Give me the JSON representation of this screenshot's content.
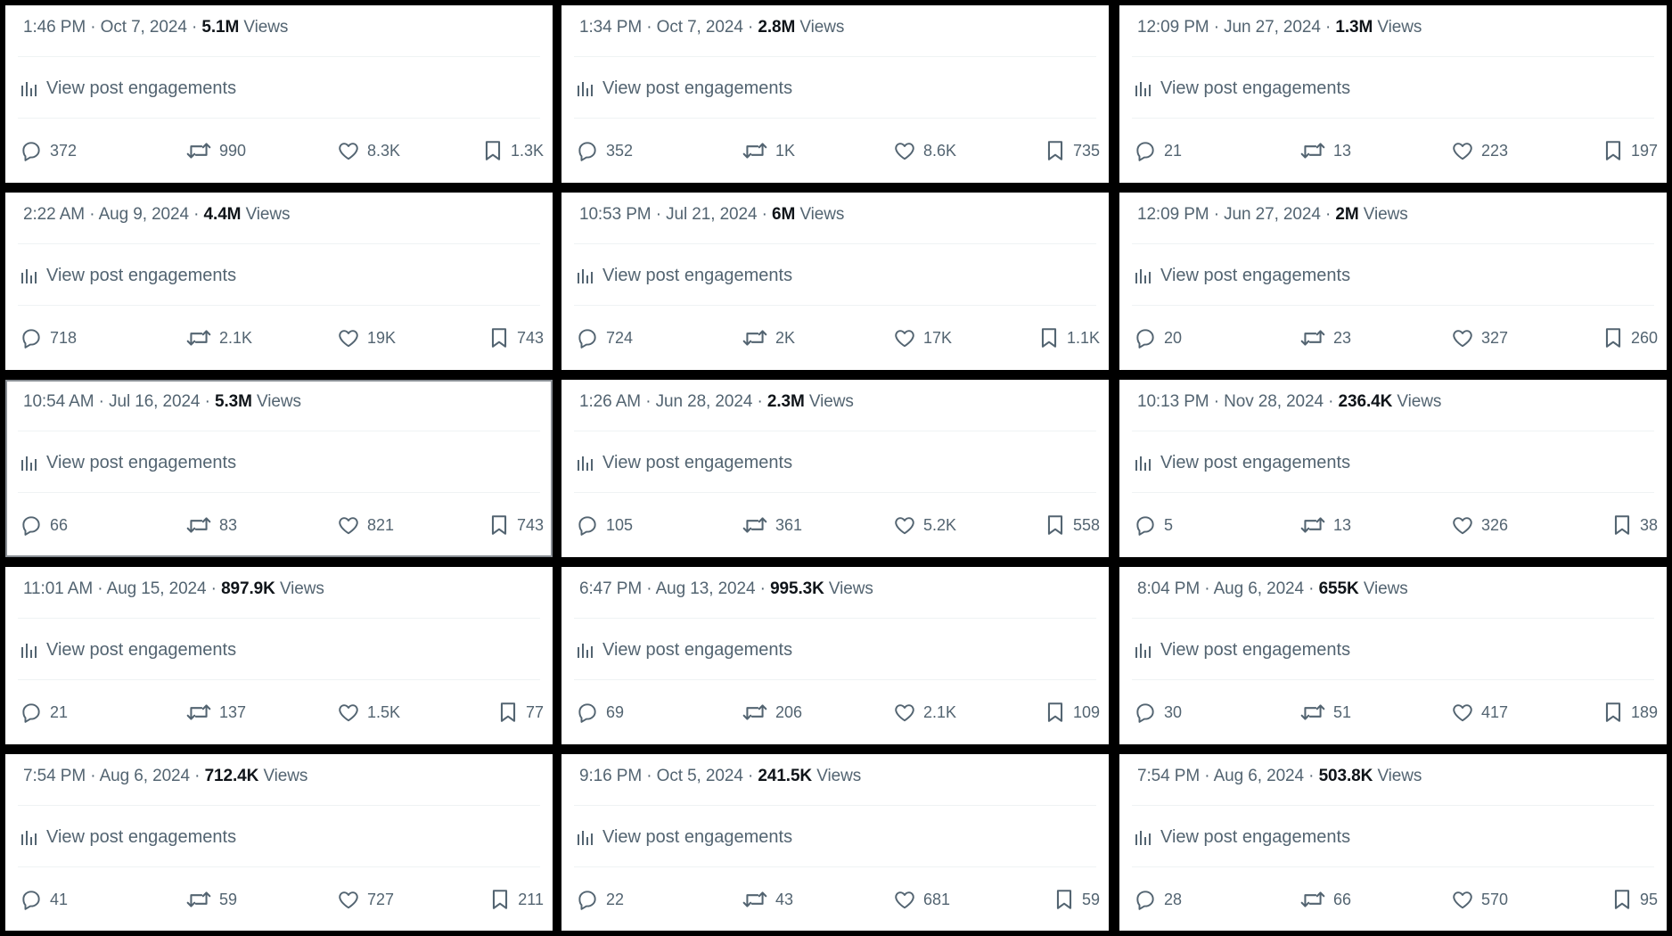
{
  "views_label": "Views",
  "engagements_label": "View post engagements",
  "colors": {
    "background": "#000000",
    "card": "#ffffff",
    "text_secondary": "#536471",
    "text_primary": "#0f1419",
    "divider": "#eff3f4"
  },
  "icons": [
    "reply-icon",
    "repost-icon",
    "like-icon",
    "bookmark-icon",
    "analytics-icon"
  ],
  "cards": [
    {
      "time": "1:46 PM",
      "date": "Oct 7, 2024",
      "views": "5.1M",
      "replies": "372",
      "reposts": "990",
      "likes": "8.3K",
      "bookmarks": "1.3K"
    },
    {
      "time": "1:34 PM",
      "date": "Oct 7, 2024",
      "views": "2.8M",
      "replies": "352",
      "reposts": "1K",
      "likes": "8.6K",
      "bookmarks": "735"
    },
    {
      "time": "12:09 PM",
      "date": "Jun 27, 2024",
      "views": "1.3M",
      "replies": "21",
      "reposts": "13",
      "likes": "223",
      "bookmarks": "197"
    },
    {
      "time": "2:22 AM",
      "date": "Aug 9, 2024",
      "views": "4.4M",
      "replies": "718",
      "reposts": "2.1K",
      "likes": "19K",
      "bookmarks": "743"
    },
    {
      "time": "10:53 PM",
      "date": "Jul 21, 2024",
      "views": "6M",
      "replies": "724",
      "reposts": "2K",
      "likes": "17K",
      "bookmarks": "1.1K"
    },
    {
      "time": "12:09 PM",
      "date": "Jun 27, 2024",
      "views": "2M",
      "replies": "20",
      "reposts": "23",
      "likes": "327",
      "bookmarks": "260"
    },
    {
      "time": "10:54 AM",
      "date": "Jul 16, 2024",
      "views": "5.3M",
      "replies": "66",
      "reposts": "83",
      "likes": "821",
      "bookmarks": "743"
    },
    {
      "time": "1:26 AM",
      "date": "Jun 28, 2024",
      "views": "2.3M",
      "replies": "105",
      "reposts": "361",
      "likes": "5.2K",
      "bookmarks": "558"
    },
    {
      "time": "10:13 PM",
      "date": "Nov 28, 2024",
      "views": "236.4K",
      "replies": "5",
      "reposts": "13",
      "likes": "326",
      "bookmarks": "38"
    },
    {
      "time": "11:01 AM",
      "date": "Aug 15, 2024",
      "views": "897.9K",
      "replies": "21",
      "reposts": "137",
      "likes": "1.5K",
      "bookmarks": "77"
    },
    {
      "time": "6:47 PM",
      "date": "Aug 13, 2024",
      "views": "995.3K",
      "replies": "69",
      "reposts": "206",
      "likes": "2.1K",
      "bookmarks": "109"
    },
    {
      "time": "8:04 PM",
      "date": "Aug 6, 2024",
      "views": "655K",
      "replies": "30",
      "reposts": "51",
      "likes": "417",
      "bookmarks": "189"
    },
    {
      "time": "7:54 PM",
      "date": "Aug 6, 2024",
      "views": "712.4K",
      "replies": "41",
      "reposts": "59",
      "likes": "727",
      "bookmarks": "211"
    },
    {
      "time": "9:16 PM",
      "date": "Oct 5, 2024",
      "views": "241.5K",
      "replies": "22",
      "reposts": "43",
      "likes": "681",
      "bookmarks": "59"
    },
    {
      "time": "7:54 PM",
      "date": "Aug 6, 2024",
      "views": "503.8K",
      "replies": "28",
      "reposts": "66",
      "likes": "570",
      "bookmarks": "95"
    }
  ]
}
